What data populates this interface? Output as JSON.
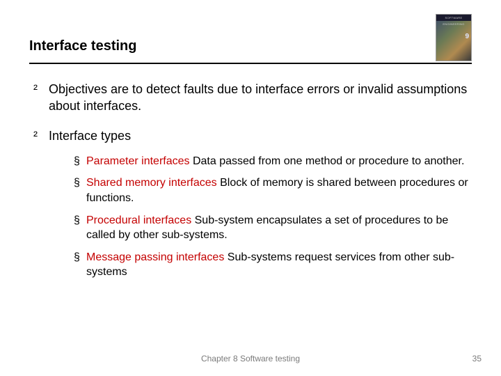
{
  "title": "Interface testing",
  "book_label": "SOFTWARE ENGINEERING",
  "book_edition": "9",
  "bullets": {
    "objectives": "Objectives are to detect faults due to interface errors or invalid assumptions about interfaces.",
    "types_label": "Interface types"
  },
  "interface_types": [
    {
      "term": "Parameter interfaces",
      "desc": " Data passed from one method or procedure to another."
    },
    {
      "term": "Shared memory interfaces",
      "desc": " Block of memory is shared between procedures or functions."
    },
    {
      "term": "Procedural interfaces",
      "desc": " Sub-system encapsulates a set of procedures to be called by other sub-systems."
    },
    {
      "term": "Message passing interfaces",
      "desc": " Sub-systems request services from other sub-systems"
    }
  ],
  "footer": "Chapter 8 Software testing",
  "page_number": "35"
}
